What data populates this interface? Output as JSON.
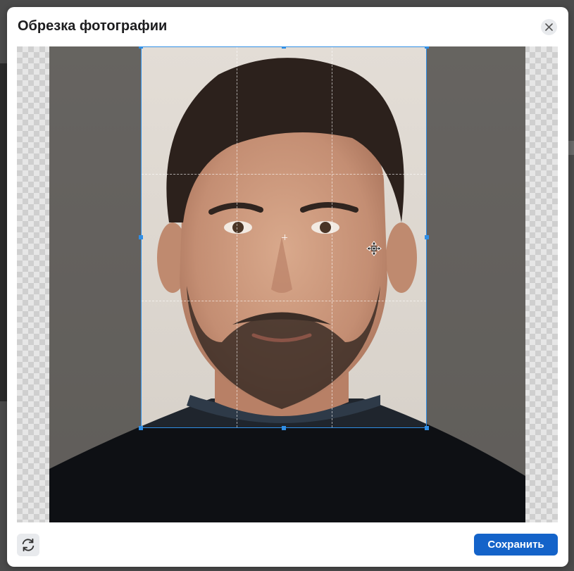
{
  "modal": {
    "title": "Обрезка фотографии",
    "save_label": "Сохранить"
  },
  "icons": {
    "close": "close-icon",
    "rotate": "rotate-icon",
    "move_cursor": "move-cursor-icon"
  },
  "colors": {
    "accent": "#1463c9",
    "crop_border": "#2f8ee5"
  }
}
